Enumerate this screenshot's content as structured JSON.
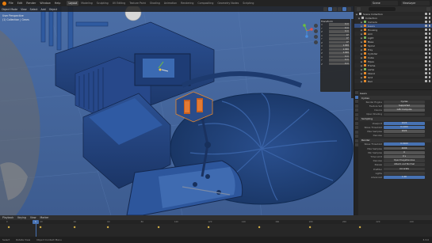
{
  "app": {
    "menus": [
      "File",
      "Edit",
      "Render",
      "Window",
      "Help"
    ],
    "workspaces": [
      "Layout",
      "Modeling",
      "Sculpting",
      "UV Editing",
      "Texture Paint",
      "Shading",
      "Animation",
      "Rendering",
      "Compositing",
      "Geometry Nodes",
      "Scripting"
    ],
    "active_workspace": "Layout",
    "scene": "Scene",
    "view_layer": "ViewLayer"
  },
  "viewport": {
    "header": [
      "Object Mode",
      "View",
      "Select",
      "Add",
      "Object"
    ],
    "overlay_lines": [
      "User Perspective",
      "(1) Collection | Gears"
    ],
    "npanel": {
      "title": "Transform",
      "rows": [
        {
          "label": "X",
          "value": "0 m"
        },
        {
          "label": "Y",
          "value": "0 m"
        },
        {
          "label": "Z",
          "value": "0 m"
        },
        {
          "label": "X",
          "value": "0°"
        },
        {
          "label": "Y",
          "value": "0°"
        },
        {
          "label": "Z",
          "value": "0°"
        },
        {
          "label": "X",
          "value": "1.000"
        },
        {
          "label": "Y",
          "value": "1.000"
        },
        {
          "label": "Z",
          "value": "1.000"
        },
        {
          "label": "X",
          "value": "0 m"
        },
        {
          "label": "Y",
          "value": "0 m"
        },
        {
          "label": "Z",
          "value": "0 m"
        }
      ]
    },
    "colors": {
      "bg": "#4a6aa0",
      "object": "#2b4f8c",
      "highlight": "#e8882a"
    }
  },
  "outliner": {
    "rows": [
      {
        "label": "Scene Collection",
        "icon": "w",
        "sel": false
      },
      {
        "label": "Collection",
        "icon": "w",
        "sel": false
      },
      {
        "label": "Camera",
        "icon": "g",
        "sel": false
      },
      {
        "label": "Gears",
        "icon": "o",
        "sel": true
      },
      {
        "label": "Housing",
        "icon": "o",
        "sel": false
      },
      {
        "label": "Arm",
        "icon": "o",
        "sel": false
      },
      {
        "label": "Light",
        "icon": "g",
        "sel": false
      },
      {
        "label": "Base",
        "icon": "o",
        "sel": false
      },
      {
        "label": "Spiral",
        "icon": "o",
        "sel": false
      },
      {
        "label": "Tray",
        "icon": "o",
        "sel": false
      },
      {
        "label": "Cylinder",
        "icon": "o",
        "sel": false
      },
      {
        "label": "Cube",
        "icon": "o",
        "sel": false
      },
      {
        "label": "Pipes",
        "icon": "o",
        "sel": false
      },
      {
        "label": "Frame",
        "icon": "o",
        "sel": false
      },
      {
        "label": "Lamp",
        "icon": "g",
        "sel": false
      },
      {
        "label": "Stand",
        "icon": "o",
        "sel": false
      },
      {
        "label": "Grid",
        "icon": "o",
        "sel": false
      },
      {
        "label": "Rail",
        "icon": "o",
        "sel": false
      }
    ]
  },
  "properties": {
    "header": "Gears",
    "section1": "Cycles",
    "rows1": [
      {
        "label": "Render Engine",
        "value": "Cycles",
        "style": "dark"
      },
      {
        "label": "Feature Set",
        "value": "Supported",
        "style": ""
      },
      {
        "label": "Device",
        "value": "GPU Compute",
        "style": ""
      },
      {
        "label": "Open Shading",
        "value": "",
        "style": "dark"
      }
    ],
    "section2": "Sampling",
    "rows2": [
      {
        "label": "Viewport",
        "value": "1024",
        "style": "blue"
      },
      {
        "label": "Noise Threshold",
        "value": "0.1000",
        "style": "blue"
      },
      {
        "label": "Max Samples",
        "value": "1024",
        "style": ""
      },
      {
        "label": "Denoise",
        "value": "",
        "style": "dark"
      }
    ],
    "section3": "Render",
    "rows3": [
      {
        "label": "Noise Threshold",
        "value": "0.0100",
        "style": "blue"
      },
      {
        "label": "Max Samples",
        "value": "4096",
        "style": ""
      },
      {
        "label": "Min Samples",
        "value": "0",
        "style": ""
      },
      {
        "label": "Time Limit",
        "value": "0 s",
        "style": ""
      },
      {
        "label": "Denoise",
        "value": "OpenImageDenoise",
        "style": "dark"
      },
      {
        "label": "Passes",
        "value": "Albedo and Normal",
        "style": "dark"
      },
      {
        "label": "Prefilter",
        "value": "Accurate",
        "style": "dark"
      },
      {
        "label": "Lights",
        "value": "",
        "style": "dark"
      },
      {
        "label": "Advanced",
        "value": "1.00",
        "style": "blue"
      }
    ]
  },
  "timeline": {
    "header": [
      "Playback",
      "Keying",
      "View",
      "Marker"
    ],
    "current_frame": "1",
    "ticks": [
      "0",
      "20",
      "40",
      "60",
      "80",
      "100",
      "120",
      "140",
      "160",
      "180",
      "200",
      "220",
      "240"
    ],
    "key_frames": [
      1,
      20,
      40,
      60,
      90,
      120,
      150,
      180,
      210
    ]
  },
  "statusbar": {
    "left": [
      "Select",
      "Rotate View",
      "Object Context Menu"
    ],
    "right": "3.3.0"
  }
}
